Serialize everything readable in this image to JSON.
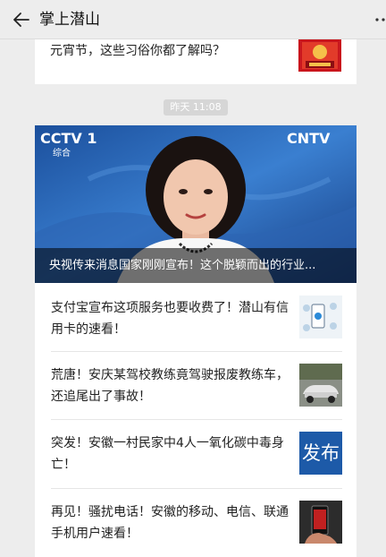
{
  "header": {
    "title": "掌上潜山",
    "back_icon": "back-arrow-icon",
    "more_icon": "more-dots-icon"
  },
  "articles_top": {
    "title": "元宵节，这些习俗你都了解吗？"
  },
  "timestamp": "昨天 11:08",
  "hero": {
    "caption": "央视传来消息国家刚刚宣布！这个脱颖而出的行业...",
    "logo_left": "CCTV 1",
    "logo_sub": "综合",
    "logo_right": "CNTV"
  },
  "list": [
    {
      "title": "支付宝宣布这项服务也要收费了！潜山有信用卡的速看！"
    },
    {
      "title": "荒唐！安庆某驾校教练竟驾驶报废教练车，还追尾出了事故！"
    },
    {
      "title": "突发！安徽一村民家中4人一氧化碳中毒身亡！",
      "thumb_text": "发布"
    },
    {
      "title": "再见！骚扰电话！安徽的移动、电信、联通手机用户速看！"
    }
  ],
  "colors": {
    "background": "#ededed",
    "card": "#ffffff",
    "badge": "#d6d6d6",
    "fabu_blue": "#1d5aa8"
  }
}
